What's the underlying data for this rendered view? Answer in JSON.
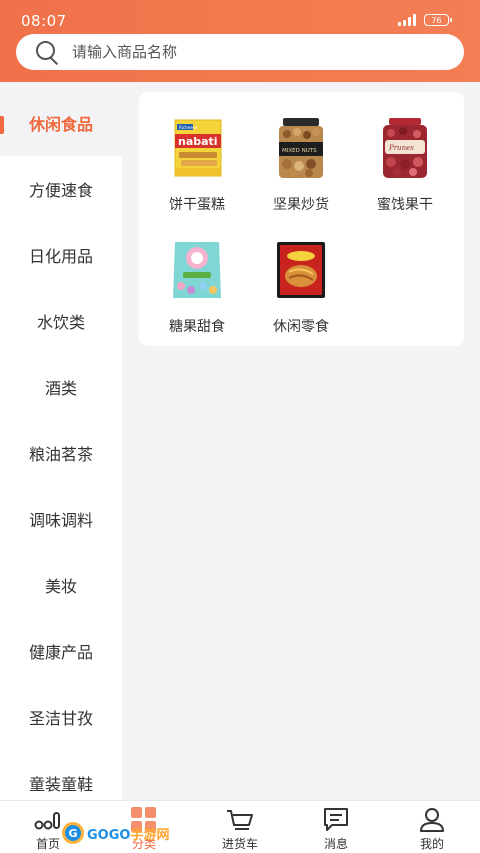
{
  "status": {
    "time": "08:07",
    "battery": "76"
  },
  "search": {
    "placeholder": "请输入商品名称"
  },
  "sidebar": {
    "items": [
      {
        "label": "休闲食品"
      },
      {
        "label": "方便速食"
      },
      {
        "label": "日化用品"
      },
      {
        "label": "水饮类"
      },
      {
        "label": "酒类"
      },
      {
        "label": "粮油茗茶"
      },
      {
        "label": "调味调料"
      },
      {
        "label": "美妆"
      },
      {
        "label": "健康产品"
      },
      {
        "label": "圣洁甘孜"
      },
      {
        "label": "童装童鞋"
      }
    ]
  },
  "products": [
    {
      "label": "饼干蛋糕",
      "icon": "wafer-package-icon"
    },
    {
      "label": "坚果炒货",
      "icon": "nut-jar-icon"
    },
    {
      "label": "蜜饯果干",
      "icon": "dried-fruit-jar-icon"
    },
    {
      "label": "糖果甜食",
      "icon": "candy-bag-icon"
    },
    {
      "label": "休闲零食",
      "icon": "snack-bag-icon"
    }
  ],
  "product_images": {
    "wafer_brand": "nabati",
    "wafer_top": "Richeese",
    "nut_band": "MIXED NUTS",
    "fruit_band": "Prunes"
  },
  "bottom_nav": {
    "items": [
      {
        "label": "首页",
        "icon": "home-icon"
      },
      {
        "label": "分类",
        "icon": "category-icon"
      },
      {
        "label": "进货车",
        "icon": "cart-icon"
      },
      {
        "label": "消息",
        "icon": "message-icon"
      },
      {
        "label": "我的",
        "icon": "profile-icon"
      }
    ]
  },
  "watermark": {
    "c": "G",
    "text_a": "GOGO",
    "text_b": "手游网"
  },
  "colors": {
    "accent": "#f06a3e",
    "header": "#f2764d",
    "background": "#f3f2f4"
  }
}
